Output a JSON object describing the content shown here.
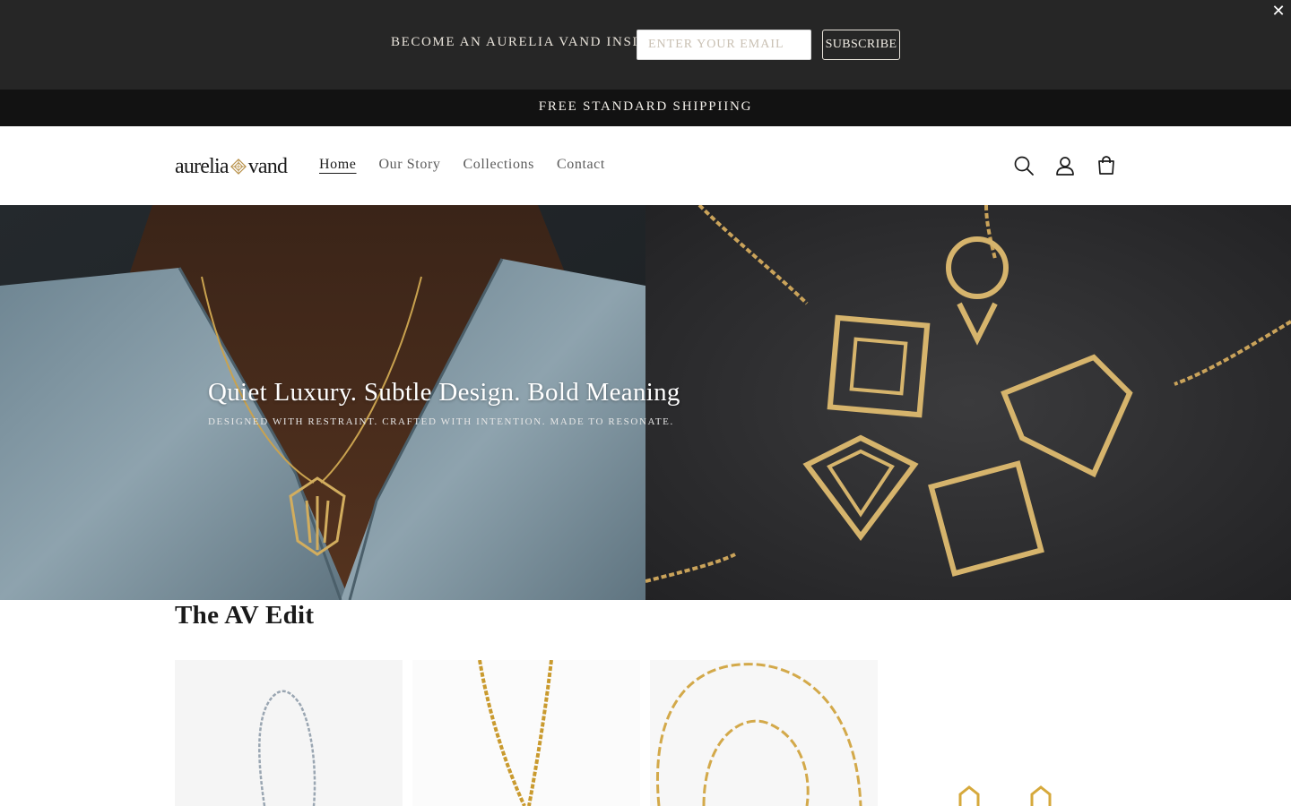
{
  "newsletter": {
    "label": "BECOME AN AURELIA VAND INSIDER",
    "email_placeholder": "ENTER YOUR EMAIL",
    "subscribe_label": "SUBSCRIBE",
    "close_icon": "close-icon"
  },
  "announcement": {
    "text": "FREE STANDARD SHIPPIING"
  },
  "header": {
    "logo_left": "aurelia",
    "logo_right": "vand",
    "nav": [
      {
        "label": "Home",
        "active": true
      },
      {
        "label": "Our Story",
        "active": false
      },
      {
        "label": "Collections",
        "active": false
      },
      {
        "label": "Contact",
        "active": false
      }
    ],
    "icons": [
      "search-icon",
      "account-icon",
      "cart-icon"
    ]
  },
  "hero": {
    "title": "Quiet Luxury. Subtle Design. Bold Meaning",
    "subtitle": "DESIGNED WITH RESTRAINT. CRAFTED WITH INTENTION. MADE TO RESONATE."
  },
  "edit": {
    "title": "The AV Edit"
  },
  "colors": {
    "newsletter_bg": "#262626",
    "announcement_bg": "#121212",
    "gold": "#c9a24f",
    "text_dark": "#1a1a1a",
    "nav_muted": "#5b5b5b"
  }
}
